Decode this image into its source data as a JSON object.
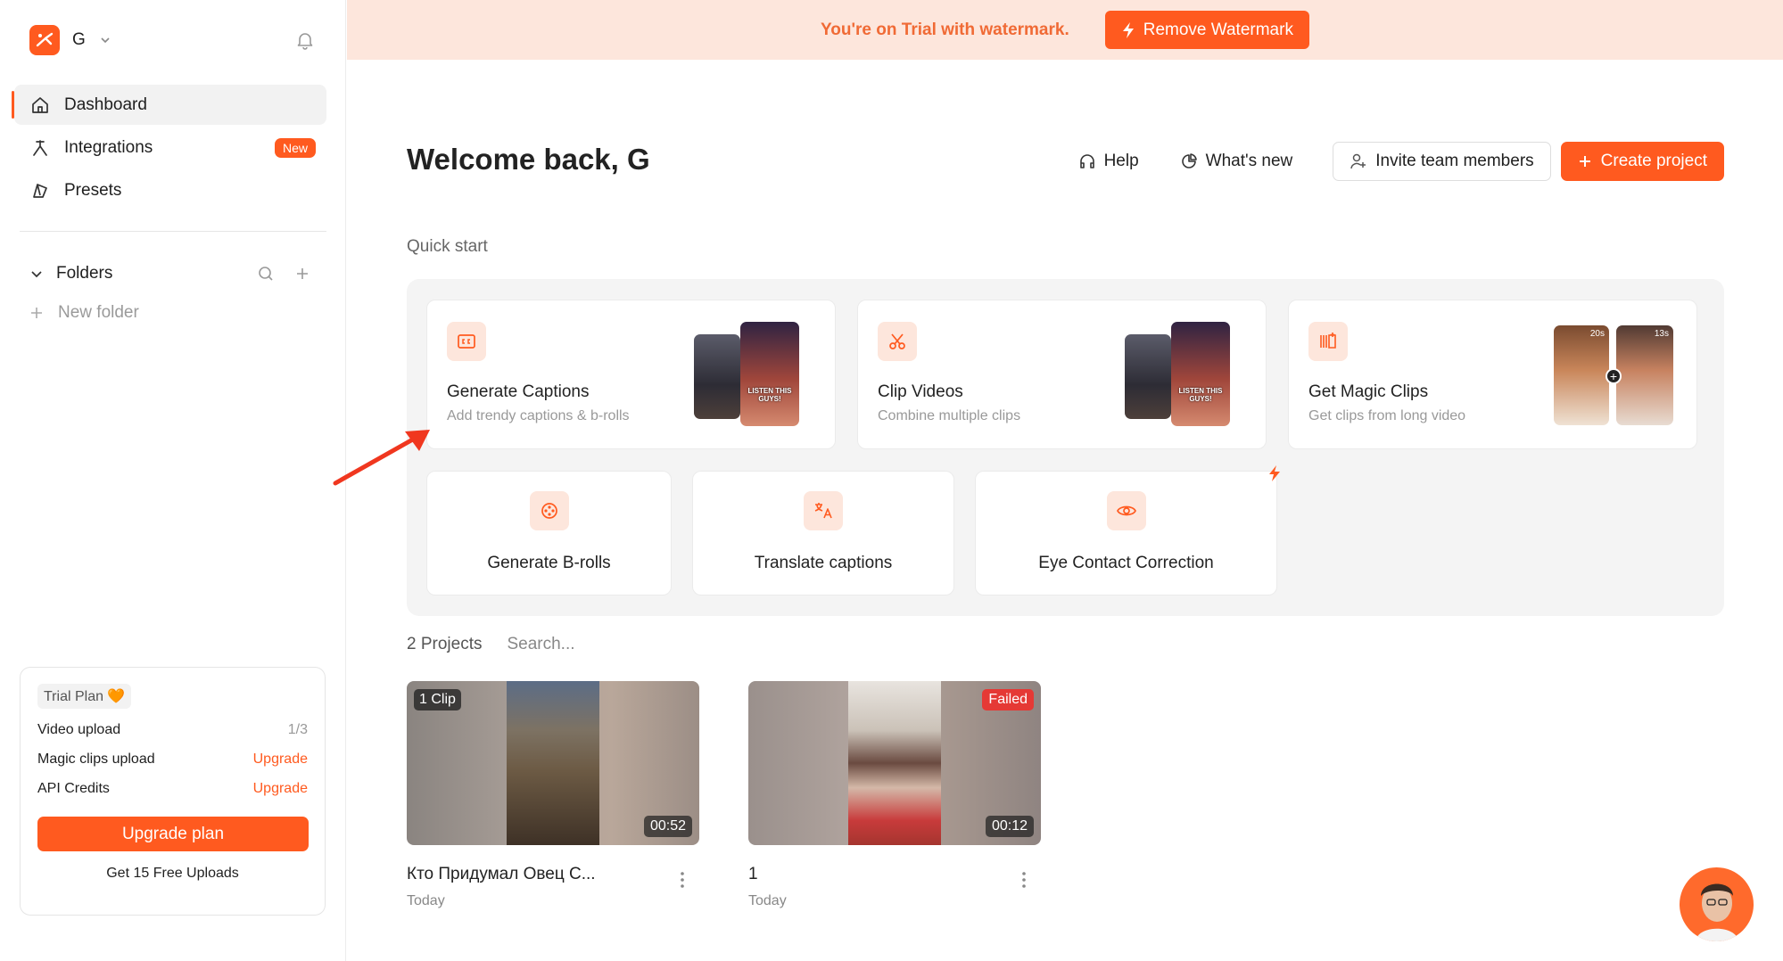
{
  "workspace": {
    "name": "G"
  },
  "sidebar": {
    "items": [
      {
        "label": "Dashboard",
        "icon": "home-icon"
      },
      {
        "label": "Integrations",
        "icon": "integrations-icon",
        "badge": "New"
      },
      {
        "label": "Presets",
        "icon": "presets-icon"
      }
    ],
    "folders_label": "Folders",
    "new_folder_label": "New folder"
  },
  "plan": {
    "badge": "Trial Plan 🧡",
    "rows": [
      {
        "label": "Video upload",
        "value": "1/3"
      },
      {
        "label": "Magic clips upload",
        "value": "Upgrade"
      },
      {
        "label": "API Credits",
        "value": "Upgrade"
      }
    ],
    "upgrade_button": "Upgrade plan",
    "free_uploads": "Get 15 Free Uploads"
  },
  "banner": {
    "text": "You're on Trial with watermark.",
    "button": "Remove Watermark"
  },
  "header": {
    "welcome": "Welcome back, G",
    "help": "Help",
    "whats_new": "What's new",
    "invite": "Invite team members",
    "create": "Create project"
  },
  "quick_start": {
    "label": "Quick start",
    "big_cards": [
      {
        "title": "Generate Captions",
        "subtitle": "Add trendy captions & b-rolls",
        "icon": "captions-icon",
        "thumb_caption": "LISTEN THIS GUYS!"
      },
      {
        "title": "Clip Videos",
        "subtitle": "Combine multiple clips",
        "icon": "scissors-icon",
        "thumb_caption": "LISTEN THIS GUYS!"
      },
      {
        "title": "Get Magic Clips",
        "subtitle": "Get clips from long video",
        "icon": "magic-clips-icon",
        "thumb_tags": [
          "20s",
          "13s"
        ]
      }
    ],
    "small_cards": [
      {
        "title": "Generate B-rolls",
        "icon": "film-reel-icon"
      },
      {
        "title": "Translate captions",
        "icon": "translate-icon"
      },
      {
        "title": "Eye Contact Correction",
        "icon": "eye-icon"
      }
    ]
  },
  "projects": {
    "count_label": "2 Projects",
    "search_placeholder": "Search...",
    "items": [
      {
        "name": "Кто Придумал Овец С...",
        "date": "Today",
        "tag": "1 Clip",
        "duration": "00:52"
      },
      {
        "name": "1",
        "date": "Today",
        "tag": "Failed",
        "duration": "00:12"
      }
    ]
  },
  "colors": {
    "accent": "#ff5a1f",
    "banner_bg": "#fde6dc",
    "failed": "#e53935"
  }
}
